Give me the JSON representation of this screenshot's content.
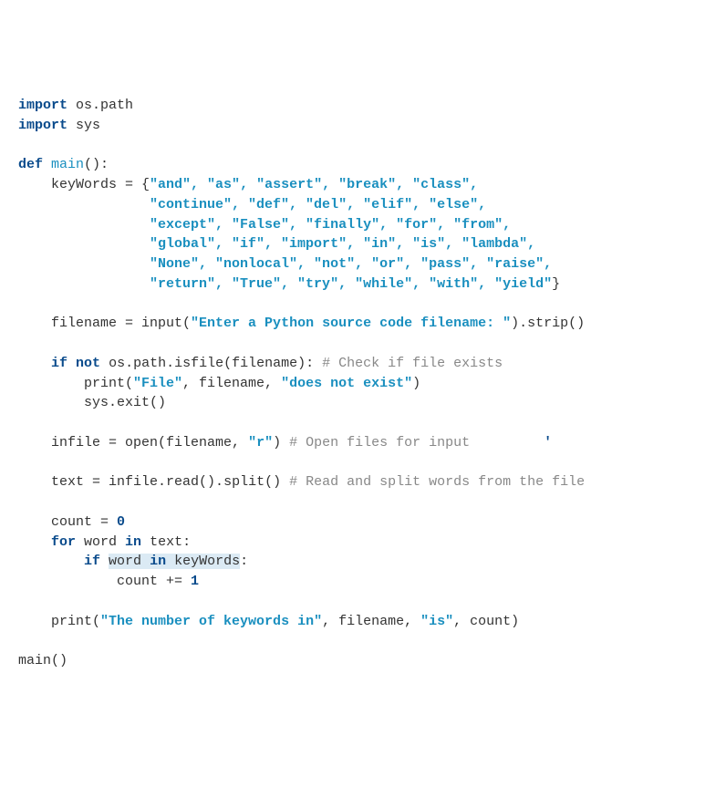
{
  "code": {
    "line01": {
      "kw_import": "import",
      "mod": "os.path"
    },
    "line02": {
      "kw_import": "import",
      "mod": "sys"
    },
    "line04": {
      "kw_def": "def",
      "name": "main",
      "parens": "():"
    },
    "line05": {
      "indent": "    ",
      "lhs": "keyWords = {",
      "items": "\"and\", \"as\", \"assert\", \"break\", \"class\",",
      "indent_cont": "                ",
      "items2": "\"continue\", \"def\", \"del\", \"elif\", \"else\",",
      "items3": "\"except\", \"False\", \"finally\", \"for\", \"from\",",
      "items4": "\"global\", \"if\", \"import\", \"in\", \"is\", \"lambda\",",
      "items5": "\"None\", \"nonlocal\", \"not\", \"or\", \"pass\", \"raise\",",
      "items6": "\"return\", \"True\", \"try\", \"while\", \"with\", \"yield\"",
      "close": "}"
    },
    "line12": {
      "indent": "    ",
      "lhs": "filename = input(",
      "arg": "\"Enter a Python source code filename: \"",
      "rhs": ").strip()"
    },
    "line14": {
      "indent": "    ",
      "kw_if": "if",
      "kw_not": "not",
      "call": " os.path.isfile(filename): ",
      "comment": "# Check if file exists"
    },
    "line15": {
      "indent": "        ",
      "p1": "print(",
      "s1": "\"File\"",
      "p2": ", filename, ",
      "s2": "\"does not exist\"",
      "p3": ")"
    },
    "line16": {
      "indent": "        ",
      "call": "sys.exit()"
    },
    "line18": {
      "indent": "    ",
      "lhs": "infile = open(filename, ",
      "mode": "\"r\"",
      "rhs": ") ",
      "comment": "# Open files for input",
      "caret_gap": "         ",
      "caret": "'"
    },
    "line20": {
      "indent": "    ",
      "lhs": "text = infile.read()",
      "caret": ".",
      "rhs": "split() ",
      "comment": "# Read and split words from the file"
    },
    "line22": {
      "indent": "    ",
      "lhs": "count = ",
      "zero": "0"
    },
    "line23": {
      "indent": "    ",
      "kw_for": "for",
      "mid": " word ",
      "kw_in": "in",
      "rhs": " text:"
    },
    "line24": {
      "indent": "        ",
      "kw_if": "if",
      "sp": " ",
      "hl_pre": "word ",
      "hl_in": "in",
      "hl_post": " keyWords",
      "colon": ":"
    },
    "line25": {
      "indent": "            ",
      "lhs": "count += ",
      "one": "1"
    },
    "line27": {
      "indent": "    ",
      "p1": "print(",
      "s1": "\"The number of keywords in\"",
      "p2": ", filename, ",
      "s2": "\"is\"",
      "p3": ", count)"
    },
    "line29": {
      "call": "main()"
    }
  }
}
